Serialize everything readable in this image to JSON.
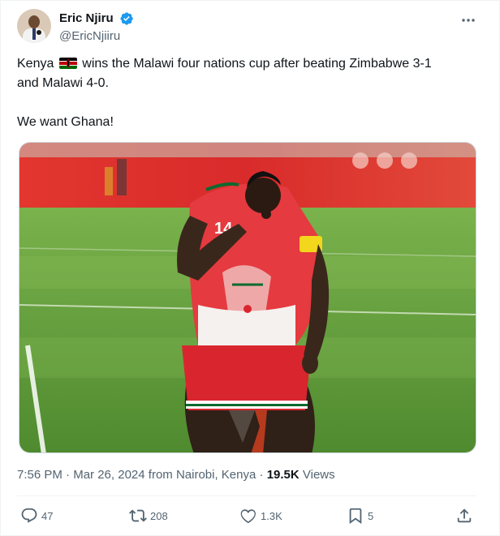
{
  "author": {
    "display_name": "Eric Njiru",
    "handle": "@EricNjiiru",
    "avatar_icon": "avatar",
    "verified_icon": "verified-badge-icon",
    "verified_color": "#1d9bf0"
  },
  "tweet": {
    "line1_before_flag": "Kenya",
    "flag_icon": "kenya-flag-icon",
    "line1_after_flag": "wins the Malawi four nations cup after beating Zimbabwe 3-1",
    "line2": "and Malawi 4-0.",
    "line3": "We want Ghana!"
  },
  "meta": {
    "time": "7:56 PM",
    "separator1": "·",
    "date": "Mar 26, 2024",
    "location": "from Nairobi, Kenya",
    "separator2": "·",
    "views_count": "19.5K",
    "views_label": "Views"
  },
  "actions": {
    "replies": "47",
    "reposts": "208",
    "likes": "1.3K",
    "bookmarks": "5"
  },
  "colors": {
    "text_primary": "#0f1419",
    "text_secondary": "#536471",
    "jersey_red": "#d9262e",
    "pitch_green": "#5c9a3a"
  }
}
